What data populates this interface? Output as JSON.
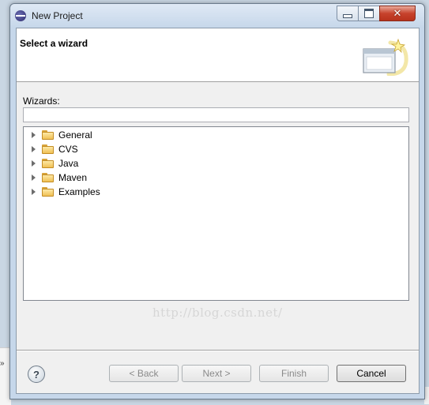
{
  "window": {
    "title": "New Project"
  },
  "header": {
    "title": "Select a wizard"
  },
  "wizards": {
    "label": "Wizards:",
    "filter_value": "",
    "tree": [
      {
        "label": "General"
      },
      {
        "label": "CVS"
      },
      {
        "label": "Java"
      },
      {
        "label": "Maven"
      },
      {
        "label": "Examples"
      }
    ]
  },
  "watermark": "http://blog.csdn.net/",
  "buttons": {
    "help": "?",
    "back": "< Back",
    "next": "Next >",
    "finish": "Finish",
    "cancel": "Cancel"
  },
  "background": {
    "fragment": "»"
  },
  "colors": {
    "folder": "#f0c154",
    "close": "#c7432d"
  },
  "icons": [
    "eclipse-icon",
    "minimize-icon",
    "maximize-icon",
    "close-icon",
    "wizard-banner-icon",
    "folder-icon",
    "expand-arrow-icon",
    "help-icon"
  ]
}
